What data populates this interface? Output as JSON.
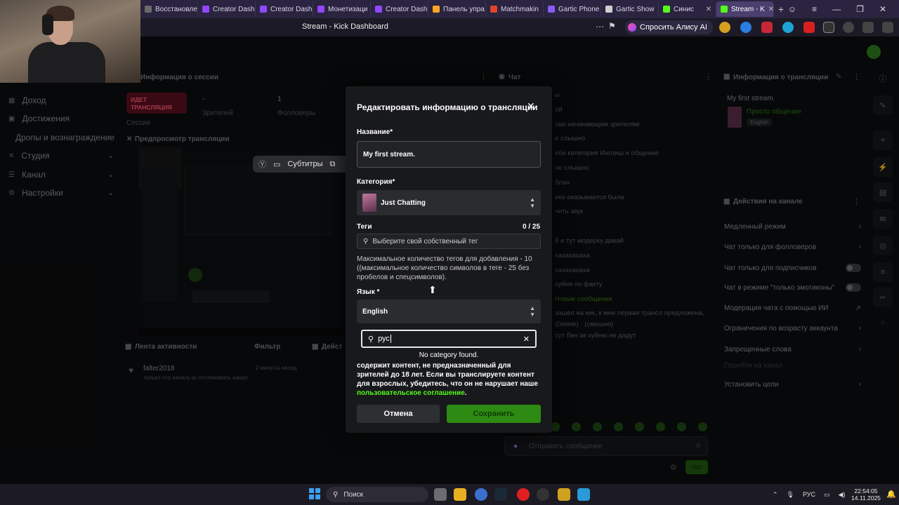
{
  "browser": {
    "tabs": [
      {
        "label": "Восстановле",
        "color": "#6a6a6a"
      },
      {
        "label": "Creator Dash",
        "color": "#9146ff"
      },
      {
        "label": "Creator Dash",
        "color": "#9146ff"
      },
      {
        "label": "Монетизаци",
        "color": "#9146ff"
      },
      {
        "label": "Creator Dash",
        "color": "#9146ff"
      },
      {
        "label": "Панель упра",
        "color": "#f5a623"
      },
      {
        "label": "Matchmakin",
        "color": "#e0442a"
      },
      {
        "label": "Gartic Phone",
        "color": "#8a5cf6"
      },
      {
        "label": "Gartic Show",
        "color": "#d0d0d0"
      },
      {
        "label": "Синис",
        "color": "#53fc18"
      },
      {
        "label": "Stream - K",
        "color": "#53fc18"
      }
    ],
    "page_title": "Stream - Kick Dashboard",
    "alice_button": "Спросить Алису AI"
  },
  "sidebar": {
    "items": [
      {
        "label": "Доход",
        "icon": "chart-icon",
        "chevron": false
      },
      {
        "label": "Достижения",
        "icon": "trophy-icon",
        "chevron": false
      },
      {
        "label": "Дропы и вознаграждение",
        "icon": "",
        "chevron": false
      },
      {
        "label": "Студия",
        "icon": "studio-icon",
        "chevron": true
      },
      {
        "label": "Канал",
        "icon": "channel-icon",
        "chevron": true
      },
      {
        "label": "Настройки",
        "icon": "gear-icon",
        "chevron": true
      }
    ]
  },
  "session": {
    "title": "Информация о сессии",
    "live_badge": "ИДЕТ ТРАНСЛЯЦИЯ",
    "session_label": "Сессия",
    "viewers_value": "-",
    "viewers_label": "Зрителей",
    "followers_value": "1",
    "followers_label": "Фолловеры"
  },
  "preview": {
    "title": "Предпросмотр трансляции",
    "toolbar": {
      "subtitles": "Субтитры"
    }
  },
  "activity": {
    "title": "Лента активности",
    "filter": "Фильтр",
    "other_panel": "Дейст",
    "entry_user": "falter2018",
    "entry_time": "2 минуты назад",
    "entry_text": "только что начал(-а) отслеживать канал"
  },
  "chat": {
    "title": "Чат",
    "lines": [
      "ы",
      "ой",
      "гаю начинающим зрителям",
      "е слышно",
      "ебя категория Инглиш и общение",
      "не слышно",
      "блан",
      "ике оказывается была",
      "чить звук",
      "",
      "й и тут модерку давай",
      "хахахахаха",
      "хахахахаха",
      "хуйня по факту"
    ],
    "new_messages": "Новые сообщения",
    "post_lines": [
      "зашел на кик, к мне первая трансл предложена,",
      "(Delete) · (смешно)",
      "сут бан за хуйню не дадут"
    ],
    "input_placeholder": "Отправить сообщение",
    "send_button": "Чат"
  },
  "stream_info": {
    "title": "Информация о трансляции",
    "stream_title": "My first stream.",
    "category": "Просто общение",
    "language": "English"
  },
  "channel_actions": {
    "title": "Действия на канале",
    "items": [
      {
        "label": "Медленный режим",
        "control": "arrow"
      },
      {
        "label": "Чат только для фолловеров",
        "control": "arrow"
      },
      {
        "label": "Чат только для подписчиков",
        "control": "toggle"
      },
      {
        "label": "Чат в режиме \"только эмотиконы\"",
        "control": "toggle"
      },
      {
        "label": "Модерация чата с помощью ИИ",
        "control": "external"
      },
      {
        "label": "Ограничения по возрасту аккаунта",
        "control": "arrow"
      },
      {
        "label": "Запрещенные слова",
        "control": "arrow"
      },
      {
        "label": "Перейти на канал",
        "control": "none"
      },
      {
        "label": "Установить цели",
        "control": "arrow"
      }
    ]
  },
  "modal": {
    "title": "Редактировать информацию о трансляции",
    "name_label": "Название*",
    "name_value": "My first stream.",
    "category_label": "Категория*",
    "category_value": "Just Chatting",
    "tags_label": "Теги",
    "tags_count": "0 / 25",
    "tags_placeholder": "Выберите свой собственный тег",
    "tags_help": "Максимальное количество тегов для добавления - 10 ((максимальное количество символов в теге - 25 без пробелов и спецсимволов).",
    "language_label": "Язык *",
    "language_value": "English",
    "language_search": "рус",
    "no_category": "No category found.",
    "warning_text": "содержит контент, не предназначенный для зрителей до 18 лет. Если вы транслируете контент для взрослых, убедитесь, что он не нарушает наше",
    "warning_link": "пользовательское соглашение",
    "cancel": "Отмена",
    "save": "Сохранить"
  },
  "taskbar": {
    "search": "Поиск",
    "lang": "РУС",
    "time": "22:54:05",
    "date": "14.11.2025"
  },
  "colors": {
    "accent": "#53fc18",
    "live": "#e91e3d",
    "save": "#2d8a12"
  }
}
